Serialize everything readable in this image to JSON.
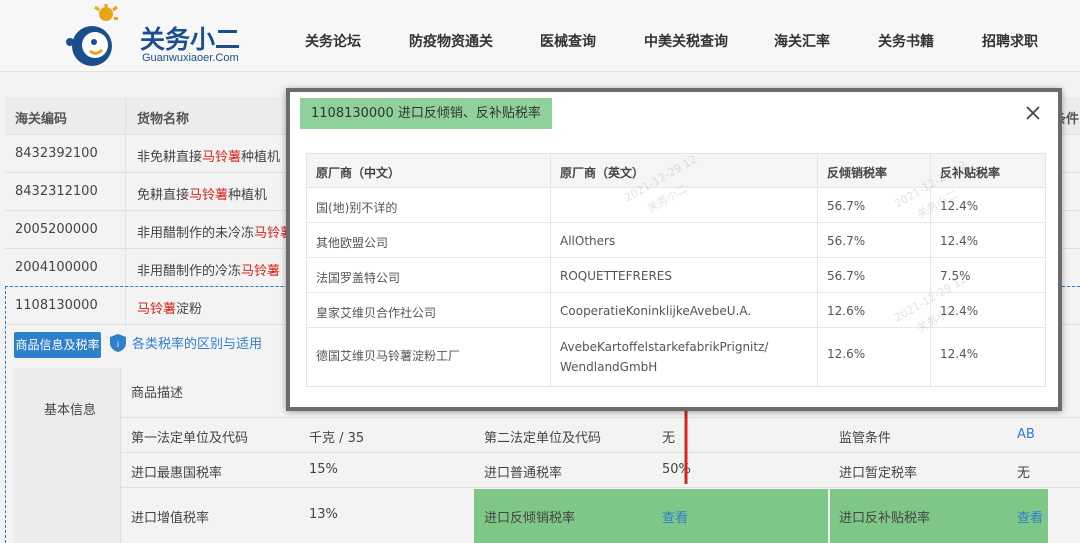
{
  "header": {
    "logo_title": "关务小二",
    "logo_sub": "Guanwuxiaoer.Com",
    "nav": [
      "关务论坛",
      "防疫物资通关",
      "医械查询",
      "中美关税查询",
      "海关汇率",
      "关务书籍",
      "招聘求职"
    ]
  },
  "goods_table": {
    "headers": [
      "海关编码",
      "货物名称"
    ],
    "header_right_fragment": "条件",
    "rows": [
      {
        "code": "8432392100",
        "pre": "非免耕直接",
        "kw": "马铃薯",
        "post": "种植机"
      },
      {
        "code": "8432312100",
        "pre": "免耕直接",
        "kw": "马铃薯",
        "post": "种植机"
      },
      {
        "code": "2005200000",
        "pre": "非用醋制作的未冷冻",
        "kw": "马铃薯",
        "post": ""
      },
      {
        "code": "2004100000",
        "pre": "非用醋制作的冷冻",
        "kw": "马铃薯",
        "post": ""
      },
      {
        "code": "1108130000",
        "pre": "",
        "kw": "马铃薯",
        "post": "淀粉"
      }
    ]
  },
  "tabs": {
    "active": "商品信息及税率",
    "link": "各类税率的区别与适用"
  },
  "attributes": {
    "section_label": "基本信息",
    "desc_label": "商品描述",
    "row1": {
      "l1": "第一法定单位及代码",
      "v1": "千克 / 35",
      "l2": "第二法定单位及代码",
      "v2": "无",
      "l3": "监管条件",
      "v3": "AB"
    },
    "row2": {
      "l1": "进口最惠国税率",
      "v1": "15%",
      "l2": "进口普通税率",
      "v2": "50%",
      "l3": "进口暂定税率",
      "v3": "无"
    },
    "row3": {
      "l1": "进口增值税率",
      "v1": "13%",
      "l2": "进口反倾销税率",
      "v2": "查看",
      "l3": "进口反补贴税率",
      "v3": "查看"
    }
  },
  "modal": {
    "title": "1108130000 进口反倾销、反补贴税率",
    "headers": [
      "原厂商（中文）",
      "原厂商（英文）",
      "反倾销税率",
      "反补贴税率"
    ],
    "rows": [
      {
        "cn": "国(地)别不详的",
        "en": "",
        "ad": "56.7%",
        "cv": "12.4%"
      },
      {
        "cn": "其他欧盟公司",
        "en": "AllOthers",
        "ad": "56.7%",
        "cv": "12.4%"
      },
      {
        "cn": "法国罗盖特公司",
        "en": "ROQUETTEFRERES",
        "ad": "56.7%",
        "cv": "7.5%"
      },
      {
        "cn": "皇家艾维贝合作社公司",
        "en": "CooperatieKoninklijkeAvebeU.A.",
        "ad": "12.6%",
        "cv": "12.4%"
      },
      {
        "cn": "德国艾维贝马铃薯淀粉工厂",
        "en": "AvebeKartoffelstarkefabrikPrignitz/WendlandGmbH",
        "ad": "12.6%",
        "cv": "12.4%"
      }
    ]
  },
  "watermark": {
    "date": "2021-12-29 12",
    "name": "关务小二"
  },
  "colors": {
    "accent_blue": "#2f80cc",
    "highlight_green": "#7ec787",
    "title_green": "#8fd19b",
    "keyword_red": "#d9251c",
    "arrow_red": "#d9251c"
  }
}
